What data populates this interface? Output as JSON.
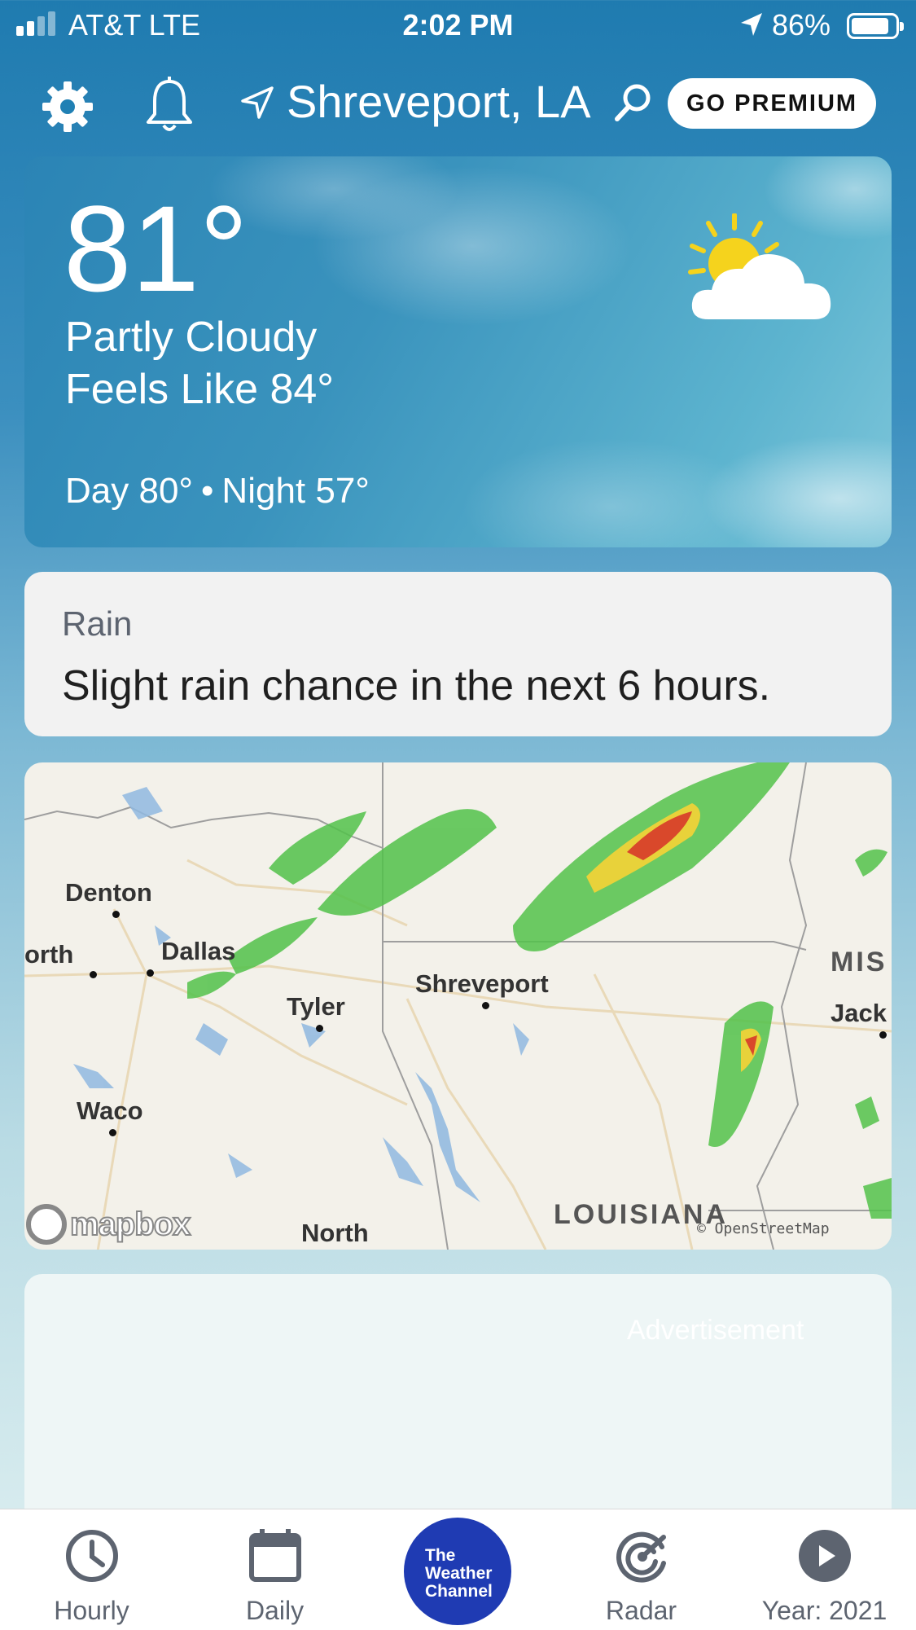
{
  "status_bar": {
    "carrier": "AT&T  LTE",
    "time": "2:02 PM",
    "battery_pct": "86%",
    "battery_level": 0.86,
    "signal_bars": 2,
    "icons": [
      "signal-icon",
      "location-services-icon",
      "battery-icon"
    ]
  },
  "header": {
    "location": "Shreveport, LA",
    "premium_label": "GO PREMIUM",
    "icons": [
      "gear-icon",
      "bell-icon",
      "location-arrow-icon",
      "search-icon"
    ]
  },
  "current": {
    "temp": "81°",
    "phrase": "Partly Cloudy",
    "feels_like": "Feels Like 84°",
    "day": "Day 80°",
    "separator": "•",
    "night": "Night 57°",
    "icon": "partly-cloudy-icon"
  },
  "rain": {
    "title": "Rain",
    "message": "Slight rain chance in the next 6 hours."
  },
  "map": {
    "cities": [
      "Denton",
      "orth",
      "Dallas",
      "Tyler",
      "Shreveport",
      "Waco",
      "North",
      "Jack"
    ],
    "region_labels": [
      "MIS",
      "LOUISIANA"
    ],
    "logo": "mapbox",
    "attribution": "© OpenStreetMap"
  },
  "ad": {
    "label": "Advertisement"
  },
  "tabs": [
    {
      "label": "Hourly",
      "icon": "clock-icon"
    },
    {
      "label": "Daily",
      "icon": "calendar-icon"
    },
    {
      "label": "The Weather Channel",
      "icon": "weather-channel-logo"
    },
    {
      "label": "Radar",
      "icon": "radar-icon"
    },
    {
      "label": "Year: 2021",
      "icon": "play-icon"
    }
  ],
  "twc_logo_lines": [
    "The",
    "Weather",
    "Channel"
  ],
  "colors": {
    "primary_blue": "#1f7bb0",
    "twc_blue": "#1f3bb3",
    "tab_gray": "#5d6470",
    "sun_yellow": "#f5d31d"
  }
}
